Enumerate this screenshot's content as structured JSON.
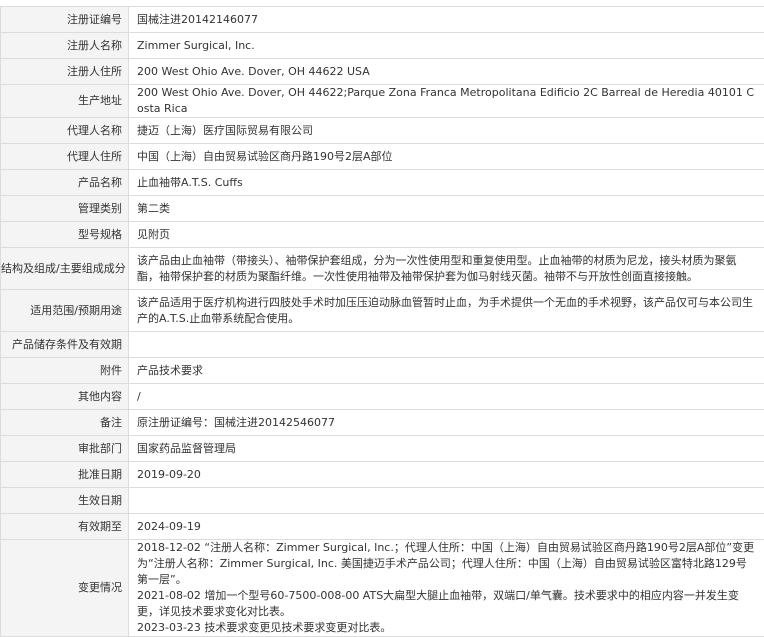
{
  "rows": [
    {
      "label": "注册证编号",
      "value": "国械注进20142146077",
      "h": 26
    },
    {
      "label": "注册人名称",
      "value": "Zimmer Surgical, Inc.",
      "h": 26
    },
    {
      "label": "注册人住所",
      "value": "200 West Ohio Ave. Dover, OH 44622 USA",
      "h": 26
    },
    {
      "label": "生产地址",
      "value": "200 West Ohio Ave. Dover, OH 44622;Parque Zona Franca Metropolitana Edificio 2C Barreal de Heredia 40101 Costa Rica",
      "h": 26
    },
    {
      "label": "代理人名称",
      "value": "捷迈（上海）医疗国际贸易有限公司",
      "h": 26
    },
    {
      "label": "代理人住所",
      "value": "中国（上海）自由贸易试验区商丹路190号2层A部位",
      "h": 26
    },
    {
      "label": "产品名称",
      "value": "止血袖带A.T.S. Cuffs",
      "h": 26
    },
    {
      "label": "管理类别",
      "value": "第二类",
      "h": 26
    },
    {
      "label": "型号规格",
      "value": "见附页",
      "h": 26
    },
    {
      "label": "结构及组成/主要组成成分",
      "value": "该产品由止血袖带（带接头）、袖带保护套组成，分为一次性使用型和重复使用型。止血袖带的材质为尼龙，接头材质为聚氨酯，袖带保护套的材质为聚酯纤维。一次性使用袖带及袖带保护套为伽马射线灭菌。袖带不与开放性创面直接接触。",
      "h": 42
    },
    {
      "label": "适用范围/预期用途",
      "value": "该产品适用于医疗机构进行四肢处手术时加压压迫动脉血管暂时止血，为手术提供一个无血的手术视野，该产品仅可与本公司生产的A.T.S.止血带系统配合使用。",
      "h": 42
    },
    {
      "label": "产品储存条件及有效期",
      "value": "",
      "h": 26
    },
    {
      "label": "附件",
      "value": "产品技术要求",
      "h": 26
    },
    {
      "label": "其他内容",
      "value": "/",
      "h": 26
    },
    {
      "label": "备注",
      "value": "原注册证编号：国械注进20142546077",
      "h": 26
    },
    {
      "label": "审批部门",
      "value": "国家药品监督管理局",
      "h": 26
    },
    {
      "label": "批准日期",
      "value": "2019-09-20",
      "h": 26
    },
    {
      "label": "生效日期",
      "value": "",
      "h": 26
    },
    {
      "label": "有效期至",
      "value": "2024-09-19",
      "h": 26
    }
  ],
  "change_record": {
    "label": "变更情况",
    "h": 92,
    "entries": [
      "2018-12-02 “注册人名称：Zimmer Surgical, Inc.；代理人住所：中国（上海）自由贸易试验区商丹路190号2层A部位”变更为“注册人名称：Zimmer Surgical, Inc. 美国捷迈手术产品公司；代理人住所：中国（上海）自由贸易试验区富特北路129号第一层”。",
      "2021-08-02 增加一个型号60-7500-008-00 ATS大扁型大腿止血袖带，双端口/单气囊。技术要求中的相应内容一并发生变更，详见技术要求变化对比表。",
      "2023-03-23 技术要求变更见技术要求变更对比表。"
    ]
  }
}
